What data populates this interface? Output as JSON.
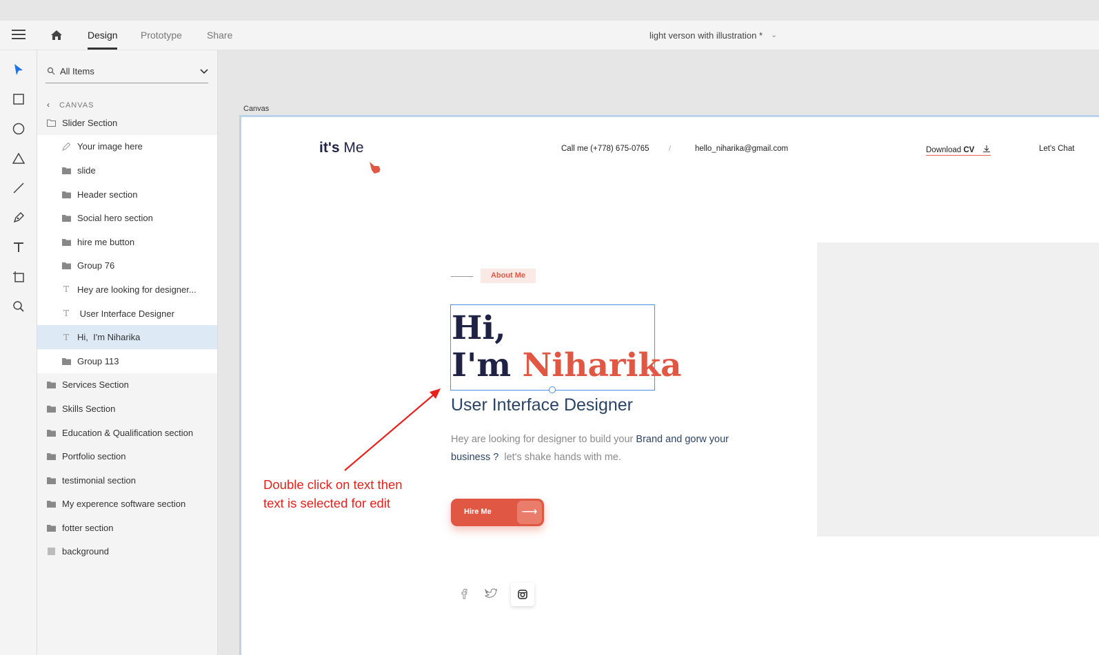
{
  "topbar": {
    "tabs": [
      {
        "label": "Design"
      },
      {
        "label": "Prototype"
      },
      {
        "label": "Share"
      }
    ],
    "document_title": "light verson with illustration *"
  },
  "tools": [
    "select-tool",
    "rectangle-tool",
    "ellipse-tool",
    "polygon-tool",
    "line-tool",
    "pen-tool",
    "text-tool",
    "artboard-tool",
    "zoom-tool"
  ],
  "layers_panel": {
    "search_label": "All Items",
    "crumb": "CANVAS",
    "items": [
      {
        "label": "Slider Section",
        "icon": "folder-open-icon"
      },
      {
        "label": "Your image here",
        "icon": "pen-icon"
      },
      {
        "label": "slide",
        "icon": "folder-icon"
      },
      {
        "label": "Header section",
        "icon": "folder-icon"
      },
      {
        "label": "Social hero section",
        "icon": "folder-icon"
      },
      {
        "label": "hire me button",
        "icon": "folder-icon"
      },
      {
        "label": "Group 76",
        "icon": "folder-icon"
      },
      {
        "label": "Hey are looking for designer...",
        "icon": "text-icon"
      },
      {
        "label": " User Interface Designer",
        "icon": "text-icon"
      },
      {
        "label": "Hi,  I'm Niharika",
        "icon": "text-icon"
      },
      {
        "label": "Group 113",
        "icon": "folder-icon"
      },
      {
        "label": "Services Section",
        "icon": "folder-icon"
      },
      {
        "label": "Skills Section",
        "icon": "folder-icon"
      },
      {
        "label": "Education & Qualification section",
        "icon": "folder-icon"
      },
      {
        "label": "Portfolio section",
        "icon": "folder-icon"
      },
      {
        "label": "testimonial section",
        "icon": "folder-icon"
      },
      {
        "label": "My experence software section",
        "icon": "folder-icon"
      },
      {
        "label": "fotter section",
        "icon": "folder-icon"
      },
      {
        "label": "background",
        "icon": "square-icon"
      }
    ],
    "selected_item": "Hi,  I'm Niharika"
  },
  "artboard": {
    "label": "Canvas",
    "logo_bold": "it's",
    "logo_light": " Me",
    "call": "Call me (+778) 675-0765",
    "separator": "/",
    "email": "hello_niharika@gmail.com",
    "download_prefix": "Download ",
    "download_bold": "CV",
    "chat": "Let's Chat",
    "about_badge": "About Me",
    "hello_line1": "Hi,",
    "hello_line2_prefix": "I'm ",
    "hello_name": "Niharika",
    "role": "User Interface Designer",
    "intro_part1": "Hey are looking for designer to build your ",
    "intro_highlight1": "Brand and gorw your business ?",
    "intro_part2": "  let's shake hands with me.",
    "hire_label": "Hire Me",
    "social_icons": [
      "facebook-icon",
      "twitter-icon",
      "instagram-icon"
    ]
  },
  "annotation": {
    "line1": "Double click on text then",
    "line2": "text is selected for edit"
  },
  "colors": {
    "accent": "#e05844",
    "navy": "#1f2244",
    "selection": "#4a90e2",
    "annotation": "#e8201c"
  }
}
